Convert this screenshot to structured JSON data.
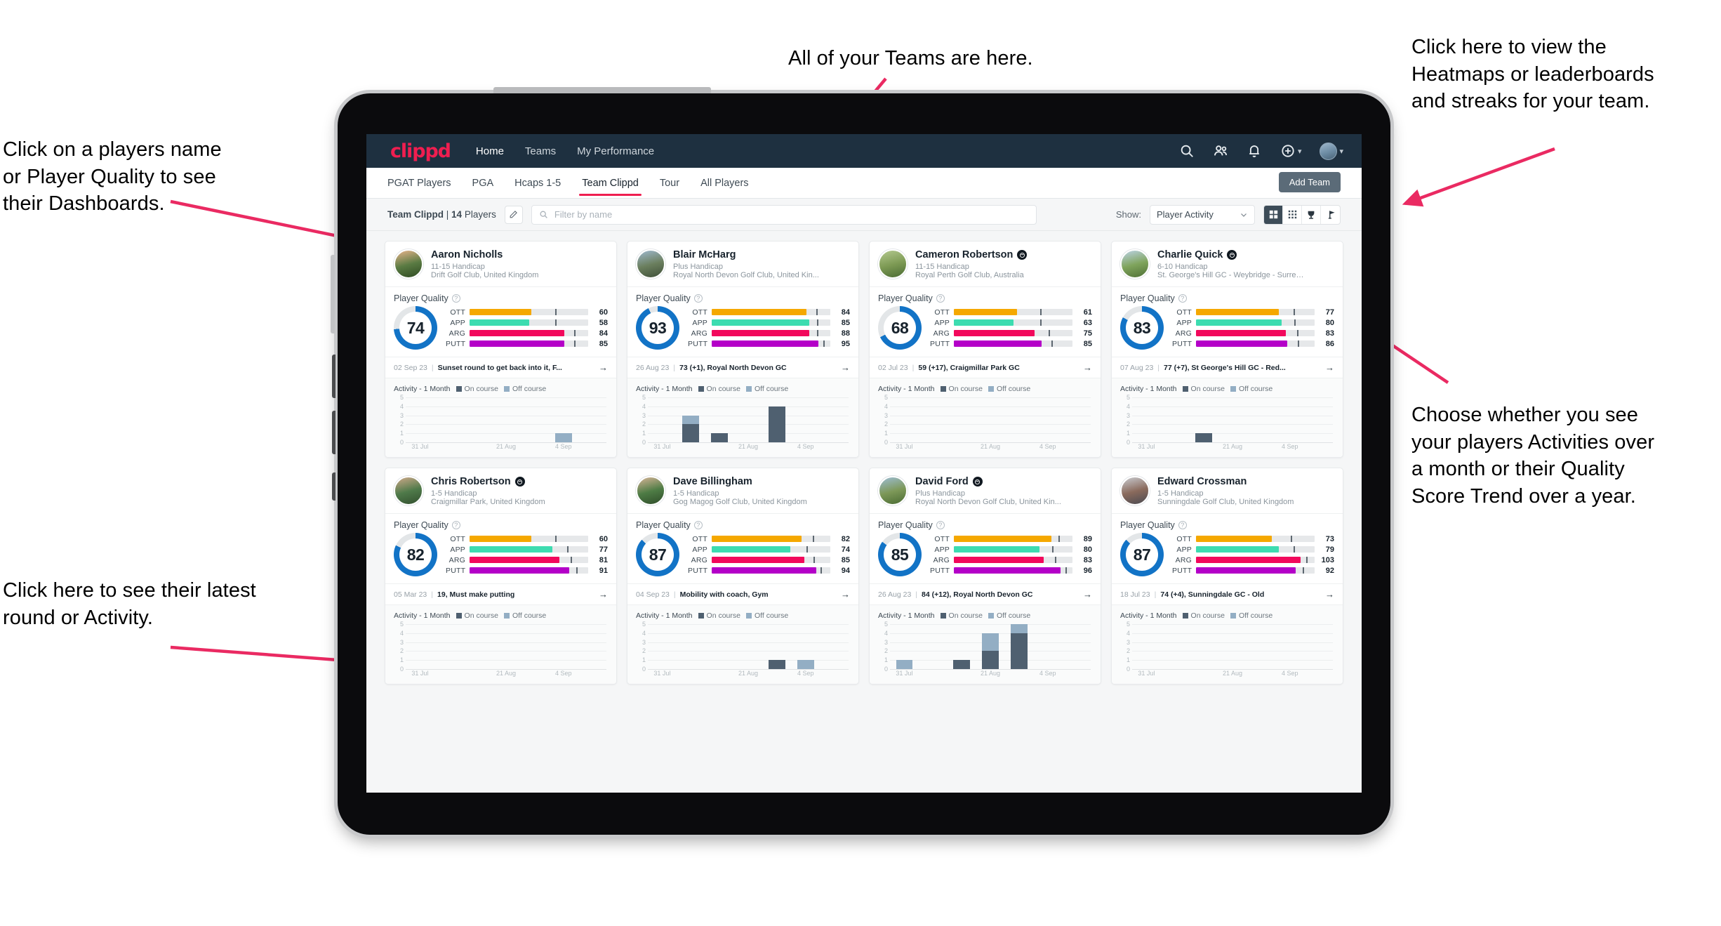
{
  "annotations": {
    "teams": "All of your Teams are here.",
    "heatmaps": "Click here to view the\nHeatmaps or leaderboards\nand streaks for your team.",
    "choose": "Choose whether you see\nyour players Activities over\na month or their Quality\nScore Trend over a year.",
    "names": "Click on a players name\nor Player Quality to see\ntheir Dashboards.",
    "latest": "Click here to see their latest\nround or Activity."
  },
  "navbar": {
    "logo": "clippd",
    "links": [
      {
        "label": "Home",
        "active": true
      },
      {
        "label": "Teams",
        "active": false
      },
      {
        "label": "My Performance",
        "active": false
      }
    ],
    "icons": [
      "search-icon",
      "people-icon",
      "bell-icon",
      "plus-circle-icon",
      "avatar"
    ]
  },
  "tabs": [
    {
      "label": "PGAT Players",
      "active": false
    },
    {
      "label": "PGA",
      "active": false
    },
    {
      "label": "Hcaps 1-5",
      "active": false
    },
    {
      "label": "Team Clippd",
      "active": true
    },
    {
      "label": "Tour",
      "active": false
    },
    {
      "label": "All Players",
      "active": false
    }
  ],
  "add_team_label": "Add Team",
  "filterbar": {
    "team_name": "Team Clippd",
    "team_divider": " | ",
    "player_count": "14",
    "players_word": " Players",
    "search_placeholder": "Filter by name",
    "show_label": "Show:",
    "show_value": "Player Activity",
    "view_modes": [
      {
        "name": "grid-view-icon",
        "active": true
      },
      {
        "name": "dense-grid-view-icon",
        "active": false
      },
      {
        "name": "trophy-view-icon",
        "active": false
      },
      {
        "name": "flag-view-icon",
        "active": false
      }
    ]
  },
  "card_labels": {
    "quality_title": "Player Quality",
    "activity_title": "Activity - 1 Month",
    "legend_on": "On course",
    "legend_off": "Off course"
  },
  "colors": {
    "brand": "#ef1e50",
    "navbar": "#1e3040",
    "ott": "#f5a800",
    "app": "#3ddcb0",
    "arg": "#f2085c",
    "putt": "#b400c8",
    "ring": "#1273c6",
    "on_course": "#4f6070",
    "off_course": "#93aec4"
  },
  "chart_data": {
    "type": "bar",
    "title": "Activity - 1 Month",
    "ylabel": "",
    "xlabel": "",
    "ylim": [
      0,
      5
    ],
    "yticks": [
      5,
      4,
      3,
      2,
      1,
      0
    ],
    "categories": [
      "31 Jul",
      "21 Aug",
      "4 Sep"
    ],
    "grid": true,
    "legend": [
      "On course",
      "Off course"
    ],
    "legend_position": "top"
  },
  "players": [
    {
      "name": "Aaron Nicholls",
      "verified": false,
      "handicap": "11-15 Handicap",
      "club": "Drift Golf Club, United Kingdom",
      "avatar_colors": [
        "#e8b48c",
        "#5a7b43",
        "#2e4a22"
      ],
      "quality": 74,
      "metrics": [
        {
          "label": "OTT",
          "value": 60,
          "fill": 52,
          "tick": 72
        },
        {
          "label": "APP",
          "value": 58,
          "fill": 50,
          "tick": 72
        },
        {
          "label": "ARG",
          "value": 84,
          "fill": 80,
          "tick": 88
        },
        {
          "label": "PUTT",
          "value": 85,
          "fill": 80,
          "tick": 88
        }
      ],
      "round_date": "02 Sep 23",
      "round_text": "Sunset round to get back into it, F...",
      "activity": {
        "on": [
          0,
          0,
          0,
          0,
          0,
          0,
          0
        ],
        "off": [
          0,
          0,
          0,
          0,
          0,
          1,
          0
        ]
      }
    },
    {
      "name": "Blair McHarg",
      "verified": false,
      "handicap": "Plus Handicap",
      "club": "Royal North Devon Golf Club, United Kin...",
      "avatar_colors": [
        "#9fb9cf",
        "#6b7f5e",
        "#3e4f38"
      ],
      "quality": 93,
      "metrics": [
        {
          "label": "OTT",
          "value": 84,
          "fill": 80,
          "tick": 88
        },
        {
          "label": "APP",
          "value": 85,
          "fill": 82,
          "tick": 89
        },
        {
          "label": "ARG",
          "value": 88,
          "fill": 82,
          "tick": 89
        },
        {
          "label": "PUTT",
          "value": 95,
          "fill": 90,
          "tick": 94
        }
      ],
      "round_date": "26 Aug 23",
      "round_text": "73 (+1), Royal North Devon GC",
      "activity": {
        "on": [
          0,
          2,
          1,
          0,
          4,
          0,
          0
        ],
        "off": [
          0,
          1,
          0,
          0,
          0,
          0,
          0
        ]
      }
    },
    {
      "name": "Cameron Robertson",
      "verified": true,
      "handicap": "11-15 Handicap",
      "club": "Royal Perth Golf Club, Australia",
      "avatar_colors": [
        "#b4c98f",
        "#7d9a54",
        "#4a6b33"
      ],
      "quality": 68,
      "metrics": [
        {
          "label": "OTT",
          "value": 61,
          "fill": 53,
          "tick": 73
        },
        {
          "label": "APP",
          "value": 63,
          "fill": 50,
          "tick": 73
        },
        {
          "label": "ARG",
          "value": 75,
          "fill": 68,
          "tick": 80
        },
        {
          "label": "PUTT",
          "value": 85,
          "fill": 74,
          "tick": 82
        }
      ],
      "round_date": "02 Jul 23",
      "round_text": "59 (+17), Craigmillar Park GC",
      "activity": {
        "on": [
          0,
          0,
          0,
          0,
          0,
          0,
          0
        ],
        "off": [
          0,
          0,
          0,
          0,
          0,
          0,
          0
        ]
      }
    },
    {
      "name": "Charlie Quick",
      "verified": true,
      "handicap": "6-10 Handicap",
      "club": "St. George's Hill GC - Weybridge - Surrey, ...",
      "avatar_colors": [
        "#bcd3e6",
        "#7fa45c",
        "#4f7036"
      ],
      "quality": 83,
      "metrics": [
        {
          "label": "OTT",
          "value": 77,
          "fill": 70,
          "tick": 82
        },
        {
          "label": "APP",
          "value": 80,
          "fill": 72,
          "tick": 83
        },
        {
          "label": "ARG",
          "value": 83,
          "fill": 76,
          "tick": 85
        },
        {
          "label": "PUTT",
          "value": 86,
          "fill": 77,
          "tick": 86
        }
      ],
      "round_date": "07 Aug 23",
      "round_text": "77 (+7), St George's Hill GC - Red...",
      "activity": {
        "on": [
          0,
          0,
          1,
          0,
          0,
          0,
          0
        ],
        "off": [
          0,
          0,
          0,
          0,
          0,
          0,
          0
        ]
      }
    },
    {
      "name": "Chris Robertson",
      "verified": true,
      "handicap": "1-5 Handicap",
      "club": "Craigmillar Park, United Kingdom",
      "avatar_colors": [
        "#cfa98a",
        "#4f7a4a",
        "#33502f"
      ],
      "quality": 82,
      "metrics": [
        {
          "label": "OTT",
          "value": 60,
          "fill": 52,
          "tick": 72
        },
        {
          "label": "APP",
          "value": 77,
          "fill": 70,
          "tick": 82
        },
        {
          "label": "ARG",
          "value": 81,
          "fill": 76,
          "tick": 85
        },
        {
          "label": "PUTT",
          "value": 91,
          "fill": 84,
          "tick": 90
        }
      ],
      "round_date": "05 Mar 23",
      "round_text": "19, Must make putting",
      "activity": {
        "on": [
          0,
          0,
          0,
          0,
          0,
          0,
          0
        ],
        "off": [
          0,
          0,
          0,
          0,
          0,
          0,
          0
        ]
      }
    },
    {
      "name": "Dave Billingham",
      "verified": false,
      "handicap": "1-5 Handicap",
      "club": "Gog Magog Golf Club, United Kingdom",
      "avatar_colors": [
        "#d7b497",
        "#4e7c45",
        "#2f4d2a"
      ],
      "quality": 87,
      "metrics": [
        {
          "label": "OTT",
          "value": 82,
          "fill": 76,
          "tick": 85
        },
        {
          "label": "APP",
          "value": 74,
          "fill": 66,
          "tick": 80
        },
        {
          "label": "ARG",
          "value": 85,
          "fill": 78,
          "tick": 86
        },
        {
          "label": "PUTT",
          "value": 94,
          "fill": 88,
          "tick": 92
        }
      ],
      "round_date": "04 Sep 23",
      "round_text": "Mobility with coach, Gym",
      "activity": {
        "on": [
          0,
          0,
          0,
          0,
          1,
          0,
          0
        ],
        "off": [
          0,
          0,
          0,
          0,
          0,
          1,
          0
        ]
      }
    },
    {
      "name": "David Ford",
      "verified": true,
      "handicap": "Plus Handicap",
      "club": "Royal North Devon Golf Club, United Kin...",
      "avatar_colors": [
        "#9dbdd4",
        "#7d9858",
        "#4a6b33"
      ],
      "quality": 85,
      "metrics": [
        {
          "label": "OTT",
          "value": 89,
          "fill": 82,
          "tick": 88
        },
        {
          "label": "APP",
          "value": 80,
          "fill": 72,
          "tick": 83
        },
        {
          "label": "ARG",
          "value": 83,
          "fill": 76,
          "tick": 85
        },
        {
          "label": "PUTT",
          "value": 96,
          "fill": 90,
          "tick": 94
        }
      ],
      "round_date": "26 Aug 23",
      "round_text": "84 (+12), Royal North Devon GC",
      "activity": {
        "on": [
          0,
          0,
          1,
          2,
          4,
          0,
          0
        ],
        "off": [
          1,
          0,
          0,
          2,
          1,
          0,
          0
        ]
      }
    },
    {
      "name": "Edward Crossman",
      "verified": false,
      "handicap": "1-5 Handicap",
      "club": "Sunningdale Golf Club, United Kingdom",
      "avatar_colors": [
        "#c9ccd1",
        "#8a6a5c",
        "#4a4a52"
      ],
      "quality": 87,
      "metrics": [
        {
          "label": "OTT",
          "value": 73,
          "fill": 64,
          "tick": 80
        },
        {
          "label": "APP",
          "value": 79,
          "fill": 70,
          "tick": 82
        },
        {
          "label": "ARG",
          "value": 103,
          "fill": 88,
          "tick": 93
        },
        {
          "label": "PUTT",
          "value": 92,
          "fill": 84,
          "tick": 90
        }
      ],
      "round_date": "18 Jul 23",
      "round_text": "74 (+4), Sunningdale GC - Old",
      "activity": {
        "on": [
          0,
          0,
          0,
          0,
          0,
          0,
          0
        ],
        "off": [
          0,
          0,
          0,
          0,
          0,
          0,
          0
        ]
      }
    }
  ]
}
